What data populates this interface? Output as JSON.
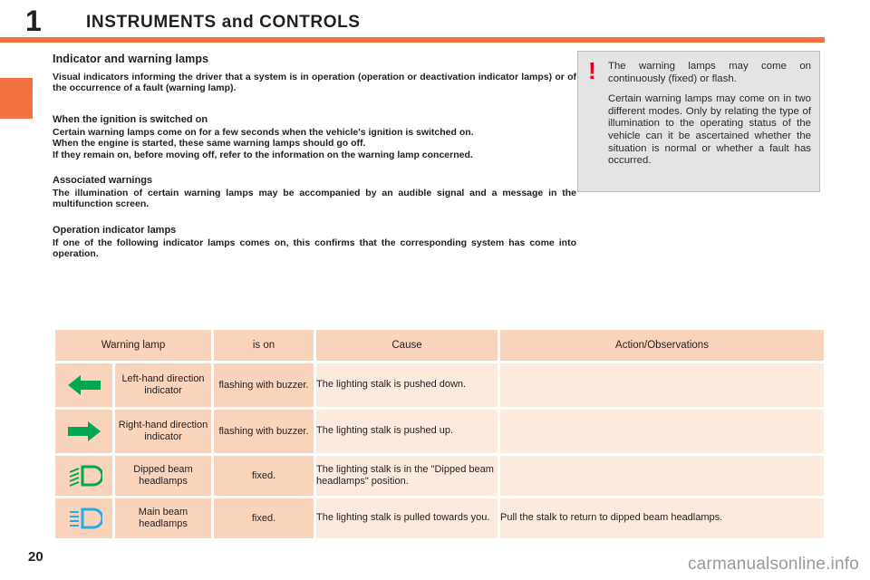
{
  "header": {
    "chapter_number": "1",
    "chapter_title": "INSTRUMENTS and CONTROLS",
    "rule_color": "#f1713f"
  },
  "content": {
    "section_title": "Indicator and warning lamps",
    "intro": "Visual indicators informing the driver that a system is in operation (operation or deactivation indicator lamps) or of the occurrence of a fault (warning lamp).",
    "blocks": [
      {
        "heading": "When the ignition is switched on",
        "lines": [
          "Certain warning lamps come on for a few seconds when the vehicle's ignition is switched on.",
          "When the engine is started, these same warning lamps should go off.",
          "If they remain on, before moving off, refer to the information on the warning lamp concerned."
        ]
      },
      {
        "heading": "Associated warnings",
        "lines": [
          "The illumination of certain warning lamps may be accompanied by an audible signal and a message in the multifunction screen."
        ]
      },
      {
        "heading": "Operation indicator lamps",
        "lines": [
          "If one of the following indicator lamps comes on, this confirms that the corresponding system has come into operation."
        ]
      }
    ]
  },
  "callout": {
    "icon": "exclamation-icon",
    "icon_glyph": "!",
    "icon_color": "#e2001a",
    "paragraphs": [
      "The warning lamps may come on continuously (fixed) or flash.",
      "Certain warning lamps may come on in two different modes. Only by relating the type of illumination to the operating status of the vehicle can it be ascertained whether the situation is normal or whether a fault has occurred."
    ]
  },
  "table": {
    "headers": [
      "Warning lamp",
      "is on",
      "Cause",
      "Action/Observations"
    ],
    "rows": [
      {
        "icon": "left-arrow-icon",
        "icon_color": "#00a651",
        "name": "Left-hand direction indicator",
        "is_on": "flashing with buzzer.",
        "cause": "The lighting stalk is pushed down.",
        "action": ""
      },
      {
        "icon": "right-arrow-icon",
        "icon_color": "#00a651",
        "name": "Right-hand direction indicator",
        "is_on": "flashing with buzzer.",
        "cause": "The lighting stalk is pushed up.",
        "action": ""
      },
      {
        "icon": "dipped-beam-headlamp-icon",
        "icon_color": "#00a651",
        "name": "Dipped beam headlamps",
        "is_on": "fixed.",
        "cause": "The lighting stalk is in the \"Dipped beam headlamps\" position.",
        "action": ""
      },
      {
        "icon": "main-beam-headlamp-icon",
        "icon_color": "#29abe2",
        "name": "Main beam headlamps",
        "is_on": "fixed.",
        "cause": "The lighting stalk is pulled towards you.",
        "action": "Pull the stalk to return to dipped beam headlamps."
      }
    ]
  },
  "footer": {
    "page_number": "20",
    "watermark": "carmanualsonline.info"
  }
}
